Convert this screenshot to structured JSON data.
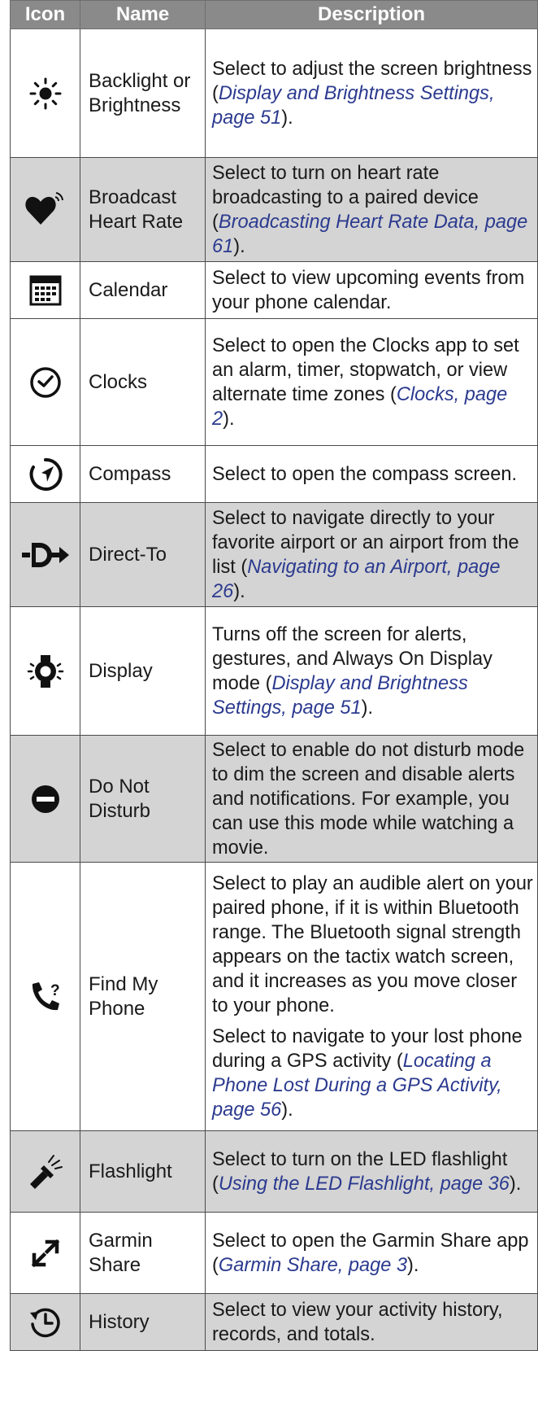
{
  "table": {
    "headers": {
      "icon": "Icon",
      "name": "Name",
      "description": "Description"
    },
    "rows": [
      {
        "icon": "sun-brightness-icon",
        "name": [
          "Backlight or",
          "Brightness"
        ],
        "desc": [
          [
            {
              "t": "Select to adjust the screen brightness ("
            },
            {
              "t": "Display and Brightness Settings, page 51",
              "link": true
            },
            {
              "t": ")."
            }
          ]
        ]
      },
      {
        "icon": "heart-broadcast-icon",
        "name": [
          "Broadcast",
          "Heart Rate"
        ],
        "desc": [
          [
            {
              "t": "Select to turn on heart rate broadcasting to a paired device ("
            },
            {
              "t": "Broadcasting Heart Rate Data, page 61",
              "link": true
            },
            {
              "t": ")."
            }
          ]
        ]
      },
      {
        "icon": "calendar-icon",
        "name": [
          "Calendar"
        ],
        "desc": [
          [
            {
              "t": "Select to view upcoming events from your phone calendar."
            }
          ]
        ]
      },
      {
        "icon": "clock-check-icon",
        "name": [
          "Clocks"
        ],
        "desc": [
          [
            {
              "t": "Select to open the Clocks app to set an alarm, timer, stopwatch, or view alternate time zones ("
            },
            {
              "t": "Clocks, page 2",
              "link": true
            },
            {
              "t": ")."
            }
          ]
        ]
      },
      {
        "icon": "compass-icon",
        "name": [
          "Compass"
        ],
        "desc": [
          [
            {
              "t": "Select to open the compass screen."
            }
          ]
        ]
      },
      {
        "icon": "direct-to-icon",
        "name": [
          "Direct-To"
        ],
        "desc": [
          [
            {
              "t": "Select to navigate directly to your favorite airport or an airport from the list ("
            },
            {
              "t": "Navigating to an Airport, page 26",
              "link": true
            },
            {
              "t": ")."
            }
          ]
        ]
      },
      {
        "icon": "display-watch-icon",
        "name": [
          "Display"
        ],
        "desc": [
          [
            {
              "t": "Turns off the screen for alerts, gestures, and Always On Display mode ("
            },
            {
              "t": "Display and Brightness Settings, page 51",
              "link": true
            },
            {
              "t": ")."
            }
          ]
        ]
      },
      {
        "icon": "do-not-disturb-icon",
        "name": [
          "Do Not",
          "Disturb"
        ],
        "desc": [
          [
            {
              "t": "Select to enable do not disturb mode to dim the screen and disable alerts and notifications. For example, you can use this mode while watching a movie."
            }
          ]
        ]
      },
      {
        "icon": "find-phone-icon",
        "name": [
          "Find My",
          "Phone"
        ],
        "desc": [
          [
            {
              "t": "Select to play an audible alert on your paired phone, if it is within Bluetooth range. The Bluetooth signal strength appears on the tactix watch screen, and it increases as you move closer to your phone."
            }
          ],
          [
            {
              "t": "Select to navigate to your lost phone during a GPS activity ("
            },
            {
              "t": "Locating a Phone Lost During a GPS Activity, page 56",
              "link": true
            },
            {
              "t": ")."
            }
          ]
        ]
      },
      {
        "icon": "flashlight-icon",
        "name": [
          "Flashlight"
        ],
        "desc": [
          [
            {
              "t": "Select to turn on the LED flashlight ("
            },
            {
              "t": "Using the LED Flashlight, page 36",
              "link": true
            },
            {
              "t": ")."
            }
          ]
        ]
      },
      {
        "icon": "garmin-share-icon",
        "name": [
          "Garmin",
          "Share"
        ],
        "desc": [
          [
            {
              "t": "Select to open the Garmin Share app ("
            },
            {
              "t": "Garmin Share, page 3",
              "link": true
            },
            {
              "t": ")."
            }
          ]
        ]
      },
      {
        "icon": "history-icon",
        "name": [
          "History"
        ],
        "desc": [
          [
            {
              "t": "Select to view your activity history, records, and totals."
            }
          ]
        ]
      }
    ]
  }
}
